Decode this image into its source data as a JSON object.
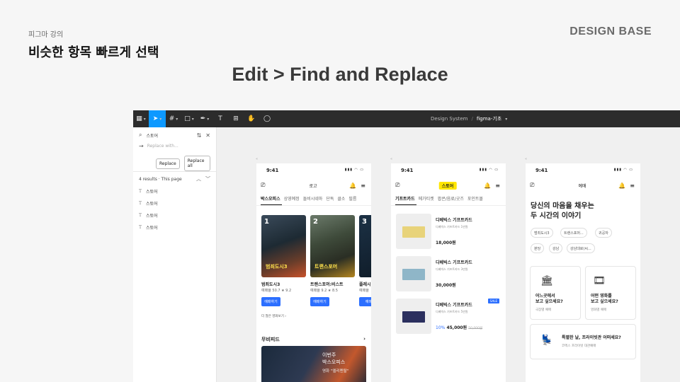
{
  "slide": {
    "course": "피그마 강의",
    "title": "비슷한 항목 빠르게 선택",
    "brand": "DESIGN BASE",
    "heading": "Edit > Find and Replace"
  },
  "figma": {
    "breadcrumb_project": "Design System",
    "breadcrumb_sep": "/",
    "breadcrumb_file": "figma-기초",
    "find_term": "스토어",
    "replace_placeholder": "Replace with...",
    "replace_button": "Replace",
    "replace_all_button": "Replace all",
    "results_label": "4 results · This page",
    "results": [
      "스토어",
      "스토어",
      "스토어",
      "스토어"
    ],
    "icons": [
      "main-menu-icon",
      "move-tool-icon",
      "frame-tool-icon",
      "shape-tool-icon",
      "pen-tool-icon",
      "text-tool-icon",
      "resources-icon",
      "hand-tool-icon",
      "comment-icon"
    ]
  },
  "phone1": {
    "time": "9:41",
    "header": "로고",
    "tabs": [
      "박스오피스",
      "상영예정",
      "돌비시네마",
      "단독",
      "클소",
      "필름"
    ],
    "movies": [
      {
        "title": "범죄도시3",
        "rating": "예매율 50.7  ★ 9.2",
        "button": "예매하기",
        "poster_text": "범죄도시3"
      },
      {
        "title": "트랜스포머:비스트",
        "rating": "예매율 9.2  ★ 8.5",
        "button": "예매하기",
        "poster_text": "트랜스포머"
      },
      {
        "title": "플레시",
        "rating": "예매율",
        "button": "예매",
        "poster_text": "3"
      }
    ],
    "more": "더 많은 영화보기  ›",
    "section": "무비피드",
    "banner_line1": "이번주",
    "banner_line2": "박스오피스",
    "banner_sub": "영화 \"엘리멘탈\""
  },
  "phone2": {
    "time": "9:41",
    "header": "스토어",
    "tabs": [
      "기프트카드",
      "메가티켓",
      "팝콘/음료/굿즈",
      "포인트몰"
    ],
    "cards": [
      {
        "name": "디베빅스 기프트카드",
        "sub": "디베빅스 기프트카드 1만원",
        "price": "18,000원",
        "color": "#e8d37a"
      },
      {
        "name": "디베빅스 기프트카드",
        "sub": "디베빅스 기프트카드 3만원",
        "price": "30,000원",
        "color": "#8fb6c8"
      },
      {
        "name": "디베빅스 기프트카드",
        "sub": "디베빅스 기프트카드 5만원",
        "discount": "10%",
        "price": "45,000원",
        "original": "50,000원",
        "badge": "SALE",
        "color": "#2b2f5e"
      }
    ]
  },
  "phone3": {
    "time": "9:41",
    "header": "예매",
    "title_line1": "당신의 마음을 채우는",
    "title_line2": "두 시간의 이야기",
    "chips": [
      "범죄도시3",
      "트랜스포머...",
      "귀공자",
      "분당",
      "강남",
      "강남대로(씨..."
    ],
    "tiles": [
      {
        "title1": "어느곳에서",
        "title2": "보고 싶으세요?",
        "sub": "극장별 예매",
        "emoji": "🏛"
      },
      {
        "title1": "어떤 영화를",
        "title2": "보고 싶으세요?",
        "sub": "영화별 예매",
        "emoji": "🎞"
      },
      {
        "title1": "특별한 날, 프라이빗관 어떠세요?",
        "sub": "코엑스 프라이빗 대관예매",
        "emoji": "💺"
      }
    ]
  }
}
